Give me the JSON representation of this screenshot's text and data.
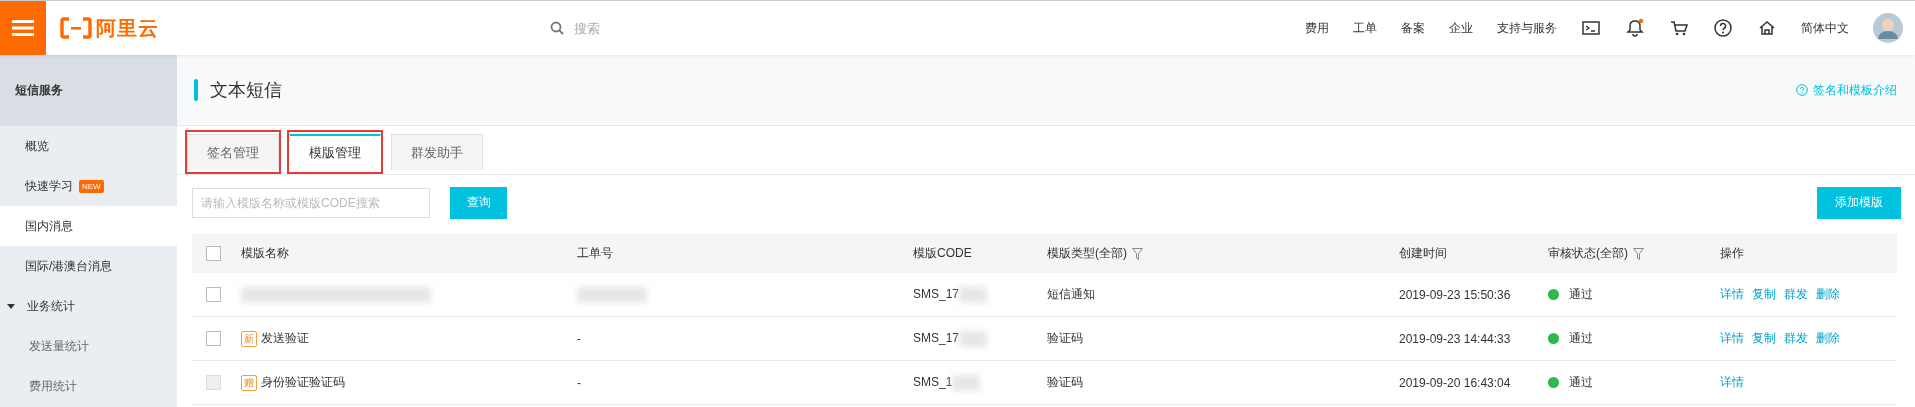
{
  "topbar": {
    "logo": "阿里云",
    "search": {
      "placeholder": "搜索"
    },
    "nav": [
      "费用",
      "工单",
      "备案",
      "企业",
      "支持与服务"
    ],
    "notification": true,
    "language": "简体中文"
  },
  "sidebar": {
    "title": "短信服务",
    "items": [
      {
        "label": "概览",
        "selected": false
      },
      {
        "label": "快速学习",
        "badge": "NEW",
        "selected": false
      },
      {
        "label": "国内消息",
        "selected": true
      },
      {
        "label": "国际/港澳台消息",
        "selected": false
      },
      {
        "label": "业务统计",
        "selected": false,
        "expanded": true,
        "children": [
          {
            "label": "发送量统计",
            "selected": false
          },
          {
            "label": "费用统计",
            "selected": false
          }
        ]
      }
    ]
  },
  "page": {
    "title": "文本短信",
    "help_link": "签名和模板介绍",
    "tabs": [
      {
        "label": "签名管理",
        "selected": false,
        "highlighted": true
      },
      {
        "label": "模版管理",
        "selected": true,
        "highlighted": true
      },
      {
        "label": "群发助手",
        "selected": false,
        "highlighted": false
      }
    ],
    "search": {
      "placeholder": "请输入模版名称或模版CODE搜索"
    },
    "query_button": "查询",
    "add_button": "添加模版",
    "table": {
      "header_checked": false,
      "columns": [
        {
          "label": "模版名称",
          "filter": false
        },
        {
          "label": "工单号",
          "filter": false
        },
        {
          "label": "模版CODE",
          "filter": false
        },
        {
          "label": "模版类型(全部)",
          "filter": true
        },
        {
          "label": "创建时间",
          "filter": false
        },
        {
          "label": "审核状态(全部)",
          "filter": true
        },
        {
          "label": "操作",
          "filter": false
        }
      ],
      "rows": [
        {
          "checked": false,
          "disabled": false,
          "name_redacted": true,
          "work_order_redacted": true,
          "code": "SMS_17",
          "code_redacted": true,
          "type": "短信通知",
          "created": "2019-09-23 15:50:36",
          "status": "通过",
          "color": "#2db84d",
          "actions": [
            "详情",
            "复制",
            "群发",
            "删除"
          ]
        },
        {
          "checked": false,
          "disabled": false,
          "tag": "新",
          "name": "发送验证",
          "work_order": "-",
          "code": "SMS_17",
          "code_redacted": true,
          "type": "验证码",
          "created": "2019-09-23 14:44:33",
          "status": "通过",
          "color": "#2db84d",
          "actions": [
            "详情",
            "复制",
            "群发",
            "删除"
          ]
        },
        {
          "checked": false,
          "disabled": true,
          "tag": "赠",
          "name": "身份验证验证码",
          "work_order": "-",
          "code": "SMS_1",
          "code_redacted": true,
          "type": "验证码",
          "created": "2019-09-20 16:43:04",
          "status": "通过",
          "color": "#2db84d",
          "actions": [
            "详情"
          ]
        }
      ]
    }
  }
}
